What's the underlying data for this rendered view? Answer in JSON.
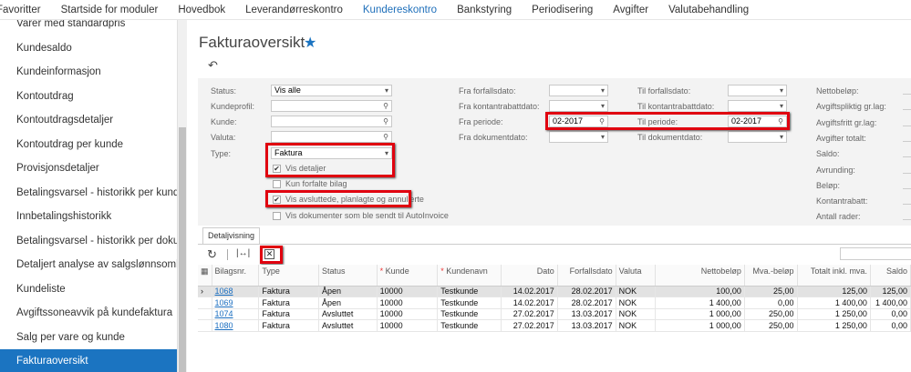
{
  "topnav": [
    "Favoritter",
    "Startside for moduler",
    "Hovedbok",
    "Leverandørreskontro",
    "Kundereskontro",
    "Bankstyring",
    "Periodisering",
    "Avgifter",
    "Valutabehandling"
  ],
  "sidebar": [
    "Varer med standardpris",
    "Kundesaldo",
    "Kundeinformasjon",
    "Kontoutdrag",
    "Kontoutdragsdetaljer",
    "Kontoutdrag per kunde",
    "Provisjonsdetaljer",
    "Betalingsvarsel - historikk per kunde",
    "Innbetalingshistorikk",
    "Betalingsvarsel - historikk per dokument",
    "Detaljert analyse av salgslønnsomhet",
    "Kundeliste",
    "Avgiftssoneavvik på kundefaktura",
    "Salg per vare og kunde",
    "Fakturaoversikt"
  ],
  "page": {
    "title": "Fakturaoversikt"
  },
  "filters": {
    "status_label": "Status:",
    "status_value": "Vis alle",
    "kundeprofil_label": "Kundeprofil:",
    "kunde_label": "Kunde:",
    "valuta_label": "Valuta:",
    "type_label": "Type:",
    "type_value": "Faktura",
    "vis_detaljer": "Vis detaljer",
    "kun_forfalte": "Kun forfalte bilag",
    "vis_avsluttede": "Vis avsluttede, planlagte og annullerte",
    "vis_autoinvoice": "Vis dokumenter som ble sendt til AutoInvoice",
    "fra_forfallsdato": "Fra forfallsdato:",
    "fra_kontantrabattdato": "Fra kontantrabattdato:",
    "fra_periode": "Fra periode:",
    "fra_periode_value": "02-2017",
    "fra_dokumentdato": "Fra dokumentdato:",
    "til_forfallsdato": "Til forfallsdato:",
    "til_kontantrabattdato": "Til kontantrabattdato:",
    "til_periode": "Til periode:",
    "til_periode_value": "02-2017",
    "til_dokumentdato": "Til dokumentdato:"
  },
  "totals": [
    "Nettobeløp:",
    "Avgiftspliktig gr.lag:",
    "Avgiftsfritt gr.lag:",
    "Avgifter totalt:",
    "Saldo:",
    "Avrunding:",
    "Beløp:",
    "Kontantrabatt:",
    "Antall rader:"
  ],
  "tab": "Detaljvisning",
  "table": {
    "headers": [
      "Bilagsnr.",
      "Type",
      "Status",
      "Kunde",
      "Kundenavn",
      "Dato",
      "Forfallsdato",
      "Valuta",
      "Nettobeløp",
      "Mva.-beløp",
      "Totalt inkl. mva.",
      "Saldo"
    ],
    "rows": [
      [
        "1068",
        "Faktura",
        "Åpen",
        "10000",
        "Testkunde",
        "14.02.2017",
        "28.02.2017",
        "NOK",
        "100,00",
        "25,00",
        "125,00",
        "125,00"
      ],
      [
        "1069",
        "Faktura",
        "Åpen",
        "10000",
        "Testkunde",
        "14.02.2017",
        "28.02.2017",
        "NOK",
        "1 400,00",
        "0,00",
        "1 400,00",
        "1 400,00"
      ],
      [
        "1074",
        "Faktura",
        "Avsluttet",
        "10000",
        "Testkunde",
        "27.02.2017",
        "13.03.2017",
        "NOK",
        "1 000,00",
        "250,00",
        "1 250,00",
        "0,00"
      ],
      [
        "1080",
        "Faktura",
        "Avsluttet",
        "10000",
        "Testkunde",
        "27.02.2017",
        "13.03.2017",
        "NOK",
        "1 000,00",
        "250,00",
        "1 250,00",
        "0,00"
      ]
    ]
  }
}
